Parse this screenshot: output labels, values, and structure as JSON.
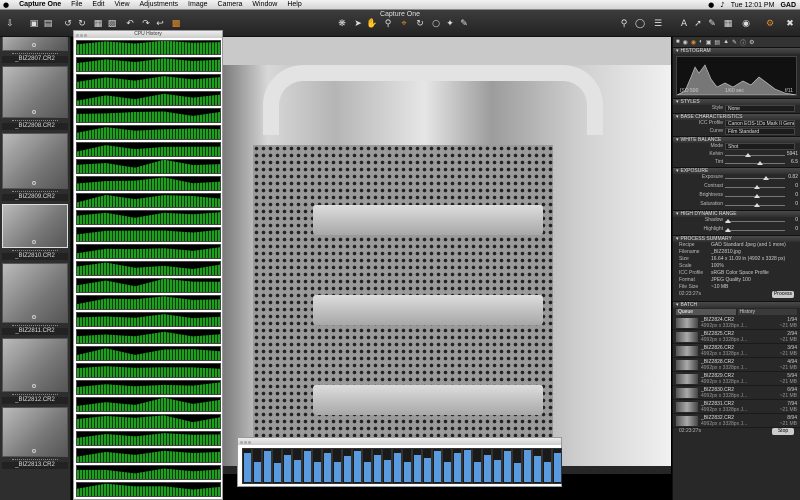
{
  "menubar": {
    "apple": "",
    "app": "Capture One",
    "items": [
      "File",
      "Edit",
      "View",
      "Adjustments",
      "Image",
      "Camera",
      "Window",
      "Help"
    ],
    "clock": "Tue 12:01 PM",
    "user": "GAD"
  },
  "window_title": "Capture One",
  "toolbar_icons": {
    "left": [
      "import-icon",
      "capture-icon",
      "layout-icon",
      "undo-icon",
      "redo-icon",
      "folder-icon",
      "trash-icon",
      "rotate-left-icon",
      "rotate-right-icon",
      "copy-icon",
      "compare-icon"
    ],
    "center": [
      "cursor-icon",
      "hand-icon",
      "zoom-icon",
      "crop-icon",
      "straighten-icon",
      "white-balance-picker-icon",
      "color-picker-icon"
    ],
    "right": [
      "search-icon",
      "zoom-icon",
      "list-icon",
      "grid-icon",
      "text-icon",
      "exposure-icon",
      "eyedropper-icon",
      "settings-icon"
    ]
  },
  "browser": {
    "thumbnails": [
      {
        "name": "_BIZ2807.CR2",
        "selected": false
      },
      {
        "name": "_BIZ2808.CR2",
        "selected": false
      },
      {
        "name": "_BIZ2809.CR2",
        "selected": false
      },
      {
        "name": "_BIZ2810.CR2",
        "selected": true
      },
      {
        "name": "_BIZ2811.CR2",
        "selected": false
      },
      {
        "name": "_BIZ2812.CR2",
        "selected": false
      },
      {
        "name": "_BIZ2813.CR2",
        "selected": false
      }
    ]
  },
  "cpu_history": {
    "title": "CPU History",
    "rows": 27
  },
  "cpu_usage_bar": {
    "levels": [
      0.85,
      0.6,
      0.9,
      0.55,
      0.8,
      0.65,
      0.9,
      0.6,
      0.85,
      0.6,
      0.75,
      0.9,
      0.6,
      0.8,
      0.65,
      0.85,
      0.6,
      0.8,
      0.7,
      0.9,
      0.6,
      0.85,
      0.95,
      0.6,
      0.8,
      0.65,
      0.9,
      0.55,
      0.95,
      0.75,
      0.6,
      0.85
    ]
  },
  "tools": {
    "histogram": {
      "title": "HISTOGRAM",
      "iso": "ISO 500",
      "shutter": "1/60 sec",
      "aperture": "f/11"
    },
    "styles": {
      "title": "STYLES",
      "style_label": "Style",
      "style_value": "None"
    },
    "base": {
      "title": "BASE CHARACTERISTICS",
      "icc_label": "ICC Profile",
      "icc_value": "Canon EOS-1Ds Mark II Generic",
      "curve_label": "Curve",
      "curve_value": "Film Standard"
    },
    "white_balance": {
      "title": "WHITE BALANCE",
      "mode_label": "Mode",
      "mode_value": "Shot",
      "kelvin_label": "Kelvin",
      "kelvin_value": "5941",
      "tint_label": "Tint",
      "tint_value": "6.5",
      "kelvin_level": 0.35,
      "tint_level": 0.55
    },
    "exposure": {
      "title": "EXPOSURE",
      "rows": [
        {
          "label": "Exposure",
          "value": "0.82",
          "level": 0.65
        },
        {
          "label": "Contrast",
          "value": "0",
          "level": 0.5
        },
        {
          "label": "Brightness",
          "value": "0",
          "level": 0.5
        },
        {
          "label": "Saturation",
          "value": "0",
          "level": 0.5
        }
      ]
    },
    "hdr": {
      "title": "HIGH DYNAMIC RANGE",
      "rows": [
        {
          "label": "Shadow",
          "value": "0",
          "level": 0.0
        },
        {
          "label": "Highlight",
          "value": "0",
          "level": 0.0
        }
      ]
    },
    "process": {
      "title": "PROCESS SUMMARY",
      "rows": [
        {
          "label": "Recipe",
          "value": "GAD Standard Jpeg (and 1 more)"
        },
        {
          "label": "Filename",
          "value": "_BIZ2810.jpg"
        },
        {
          "label": "Size",
          "value": "16.64 x 11.09 in (4992 x 3328 px)"
        },
        {
          "label": "Scale",
          "value": "100%"
        },
        {
          "label": "ICC Profile",
          "value": "sRGB Color Space Profile"
        },
        {
          "label": "Format",
          "value": "JPEG Quality 100"
        },
        {
          "label": "File Size",
          "value": "~10 MB"
        }
      ],
      "time": "02:23:27s",
      "button": "Process"
    },
    "batch": {
      "title": "BATCH",
      "tabs": [
        "Queue",
        "History"
      ],
      "items": [
        {
          "name": "_BIZ2824.CR2",
          "size": "4992px x 3328px J...",
          "count": "1/94",
          "mb": "~21 MB"
        },
        {
          "name": "_BIZ2825.CR2",
          "size": "4992px x 3328px J...",
          "count": "2/94",
          "mb": "~21 MB"
        },
        {
          "name": "_BIZ2826.CR2",
          "size": "4992px x 3328px J...",
          "count": "3/94",
          "mb": "~21 MB"
        },
        {
          "name": "_BIZ2828.CR2",
          "size": "4992px x 3328px J...",
          "count": "4/94",
          "mb": "~21 MB"
        },
        {
          "name": "_BIZ2829.CR2",
          "size": "4992px x 3328px J...",
          "count": "5/94",
          "mb": "~21 MB"
        },
        {
          "name": "_BIZ2830.CR2",
          "size": "4992px x 3328px J...",
          "count": "6/94",
          "mb": "~21 MB"
        },
        {
          "name": "_BIZ2831.CR2",
          "size": "4992px x 3328px J...",
          "count": "7/94",
          "mb": "~21 MB"
        },
        {
          "name": "_BIZ2832.CR2",
          "size": "4992px x 3328px J...",
          "count": "8/94",
          "mb": "~21 MB"
        }
      ],
      "time": "02:23:27s",
      "button": "Stop"
    }
  },
  "colors": {
    "cpu_green": "#1ea01e",
    "cpu_blue": "#5a9be0",
    "panel": "#282828"
  }
}
